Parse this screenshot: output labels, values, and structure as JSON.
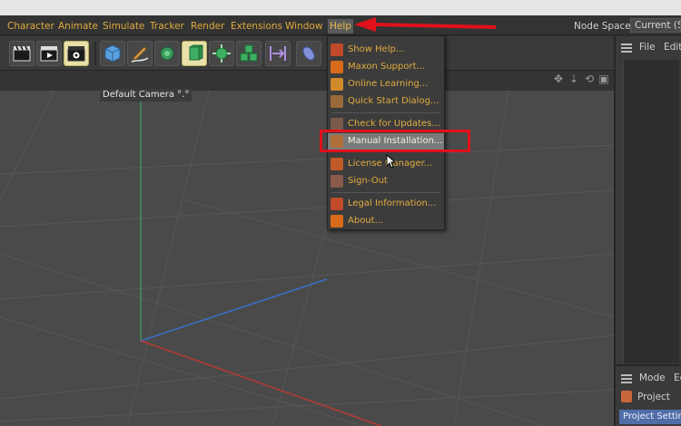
{
  "menubar": {
    "items": [
      "Character",
      "Animate",
      "Simulate",
      "Tracker",
      "Render",
      "Extensions",
      "Window",
      "Help"
    ],
    "node_space_label": "Node Space:",
    "node_space_value": "Current (St"
  },
  "toolbar": {
    "buttons": [
      "clapper-icon",
      "play-clapper-icon",
      "render-settings-icon",
      "cube-icon",
      "pen-icon",
      "subdivision-icon",
      "extrude-icon",
      "cloner-icon",
      "array-icon",
      "deformer-icon",
      "light-icon"
    ]
  },
  "viewport": {
    "camera_label": "Default Camera",
    "camera_suffix": "°.°"
  },
  "help_menu": {
    "items": [
      {
        "label": "Show Help...",
        "icon": "help-book-icon",
        "color": "#c04a2a"
      },
      {
        "label": "Maxon Support...",
        "icon": "maxon-logo-icon",
        "color": "#d86b1a"
      },
      {
        "label": "Online Learning...",
        "icon": "graduation-cap-icon",
        "color": "#d08a2a"
      },
      {
        "label": "Quick Start Dialog...",
        "icon": "quick-start-icon",
        "color": "#9a6a3a"
      },
      {
        "label": "Check for Updates...",
        "icon": "update-icon",
        "color": "#7a5a4a"
      },
      {
        "label": "Manual Installation...",
        "icon": "manual-install-icon",
        "color": "#b0703a"
      },
      {
        "label": "License Manager...",
        "icon": "license-icon",
        "color": "#c05a2a"
      },
      {
        "label": "Sign-Out",
        "icon": "sign-out-icon",
        "color": "#8a5a4a"
      },
      {
        "label": "Legal Information...",
        "icon": "legal-icon",
        "color": "#c04a2a"
      },
      {
        "label": "About...",
        "icon": "maxon-about-icon",
        "color": "#d86b1a"
      }
    ]
  },
  "right_panel": {
    "file_label": "File",
    "edit_label": "Edit",
    "mode_label": "Mode",
    "edit2_label": "Ec",
    "project_label": "Project",
    "project_settings_label": "Project Setting"
  },
  "colors": {
    "menu_text": "#e0ab3e",
    "annotation_red": "#e0111b",
    "selection_blue": "#4f6ea8"
  }
}
